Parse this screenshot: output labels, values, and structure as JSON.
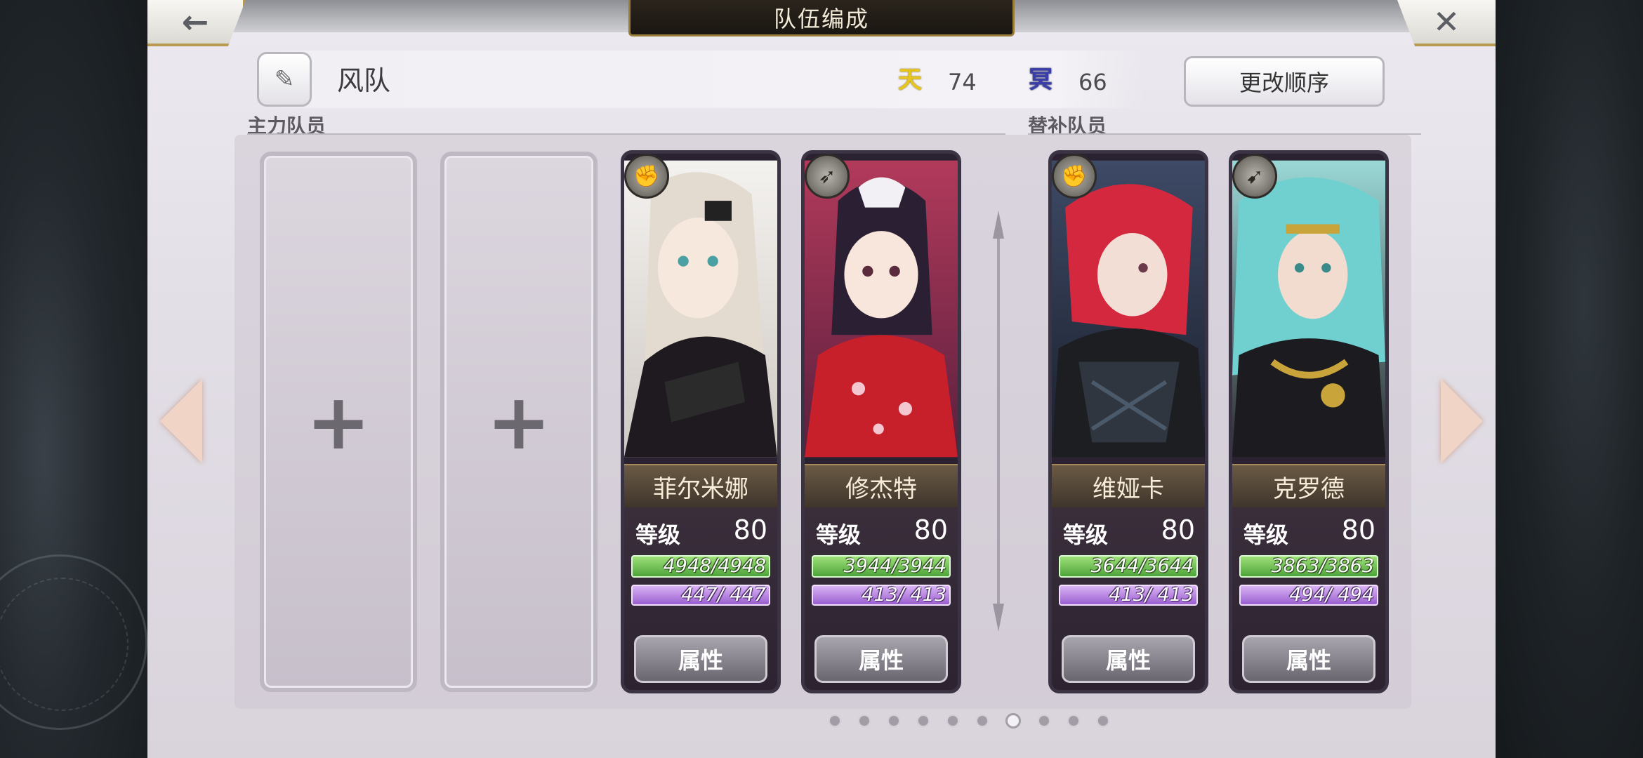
{
  "header": {
    "title": "队伍编成",
    "back_icon": "←",
    "close_icon": "✕"
  },
  "team": {
    "name": "风队",
    "edit_icon": "✎",
    "tian_icon": "天",
    "tian_value": "74",
    "ming_icon": "冥",
    "ming_value": "66",
    "order_button": "更改顺序"
  },
  "sections": {
    "main_label": "主力队员",
    "sub_label": "替补队员"
  },
  "empty_slot_icon": "+",
  "members": [
    {
      "name": "菲尔米娜",
      "level_label": "等级",
      "level": "80",
      "hp": "4948/4948",
      "mp": "447/ 447",
      "attr_button": "属性",
      "type_icon": "fist-icon",
      "colors": {
        "bg1": "#f4f2ef",
        "bg2": "#cfc9c4",
        "hair": "#e3dbcf",
        "dress": "#1e1a1f"
      }
    },
    {
      "name": "修杰特",
      "level_label": "等级",
      "level": "80",
      "hp": "3944/3944",
      "mp": "413/ 413",
      "attr_button": "属性",
      "type_icon": "spear-icon",
      "colors": {
        "bg1": "#b23a5b",
        "bg2": "#5a1f3e",
        "hair": "#2a1f33",
        "dress": "#c8202b"
      }
    },
    {
      "name": "维娅卡",
      "level_label": "等级",
      "level": "80",
      "hp": "3644/3644",
      "mp": "413/ 413",
      "attr_button": "属性",
      "type_icon": "fist-icon",
      "colors": {
        "bg1": "#3e4a66",
        "bg2": "#1a1f2c",
        "hair": "#d4283e",
        "dress": "#1d1e22"
      }
    },
    {
      "name": "克罗德",
      "level_label": "等级",
      "level": "80",
      "hp": "3863/3863",
      "mp": "494/ 494",
      "attr_button": "属性",
      "type_icon": "bow-icon",
      "colors": {
        "bg1": "#9ad8d6",
        "bg2": "#2b2a2e",
        "hair": "#6fd0cf",
        "dress": "#1c1b20"
      }
    }
  ],
  "pagination": {
    "count": 10,
    "active": 6
  }
}
